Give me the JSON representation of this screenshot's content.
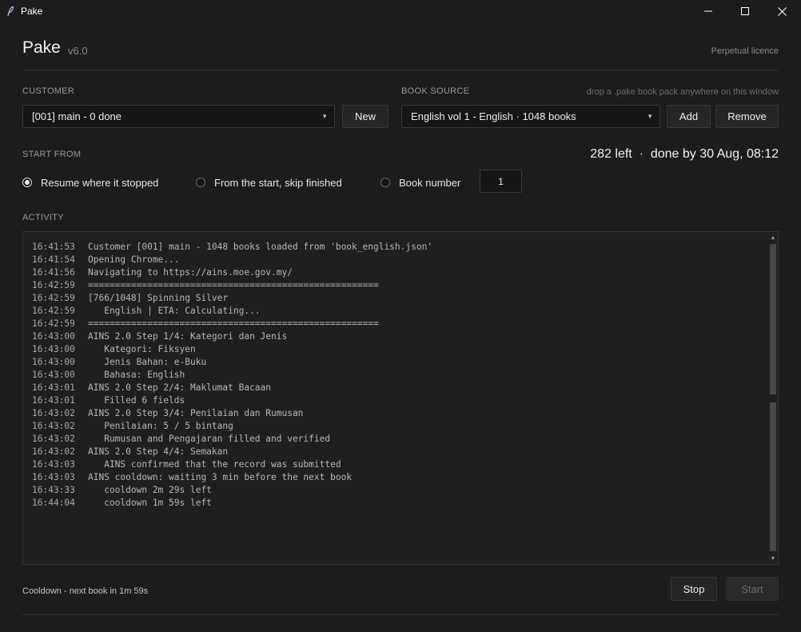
{
  "window": {
    "title": "Pake",
    "icon": "feather-icon"
  },
  "header": {
    "app_name": "Pake",
    "version": "v6.0",
    "licence": "Perpetual licence"
  },
  "customer": {
    "label": "CUSTOMER",
    "selected": "[001] main - 0 done",
    "new_label": "New"
  },
  "book_source": {
    "label": "BOOK SOURCE",
    "hint": "drop a .pake book pack anywhere on this window",
    "selected": "English vol 1 - English · 1048 books",
    "add_label": "Add",
    "remove_label": "Remove"
  },
  "start_from": {
    "label": "START FROM",
    "eta": "282 left  ·  done by 30 Aug, 08:12",
    "options": [
      {
        "label": "Resume where it stopped",
        "checked": true
      },
      {
        "label": "From the start, skip finished",
        "checked": false
      },
      {
        "label": "Book number",
        "checked": false
      }
    ],
    "book_number": "1"
  },
  "activity": {
    "label": "ACTIVITY",
    "lines": [
      {
        "ts": "16:41:53",
        "msg": "Customer [001] main - 1048 books loaded from 'book_english.json'"
      },
      {
        "ts": "16:41:54",
        "msg": "Opening Chrome..."
      },
      {
        "ts": "16:41:56",
        "msg": "Navigating to https://ains.moe.gov.my/"
      },
      {
        "ts": "16:42:59",
        "msg": "======================================================"
      },
      {
        "ts": "16:42:59",
        "msg": "[766/1048] Spinning Silver"
      },
      {
        "ts": "16:42:59",
        "msg": "   English | ETA: Calculating..."
      },
      {
        "ts": "16:42:59",
        "msg": "======================================================"
      },
      {
        "ts": "16:43:00",
        "msg": "AINS 2.0 Step 1/4: Kategori dan Jenis"
      },
      {
        "ts": "16:43:00",
        "msg": "   Kategori: Fiksyen"
      },
      {
        "ts": "16:43:00",
        "msg": "   Jenis Bahan: e-Buku"
      },
      {
        "ts": "16:43:00",
        "msg": "   Bahasa: English"
      },
      {
        "ts": "16:43:01",
        "msg": "AINS 2.0 Step 2/4: Maklumat Bacaan"
      },
      {
        "ts": "16:43:01",
        "msg": "   Filled 6 fields"
      },
      {
        "ts": "16:43:02",
        "msg": "AINS 2.0 Step 3/4: Penilaian dan Rumusan"
      },
      {
        "ts": "16:43:02",
        "msg": "   Penilaian: 5 / 5 bintang"
      },
      {
        "ts": "16:43:02",
        "msg": "   Rumusan and Pengajaran filled and verified"
      },
      {
        "ts": "16:43:02",
        "msg": "AINS 2.0 Step 4/4: Semakan"
      },
      {
        "ts": "16:43:03",
        "msg": "   AINS confirmed that the record was submitted"
      },
      {
        "ts": "16:43:03",
        "msg": "AINS cooldown: waiting 3 min before the next book"
      },
      {
        "ts": "16:43:33",
        "msg": "   cooldown 2m 29s left"
      },
      {
        "ts": "16:44:04",
        "msg": "   cooldown 1m 59s left"
      }
    ]
  },
  "footer": {
    "status": "Cooldown - next book in 1m 59s",
    "stop_label": "Stop",
    "start_label": "Start"
  },
  "colors": {
    "background": "#1c1c1c",
    "panel": "#1f1f1f",
    "border": "#333333"
  }
}
